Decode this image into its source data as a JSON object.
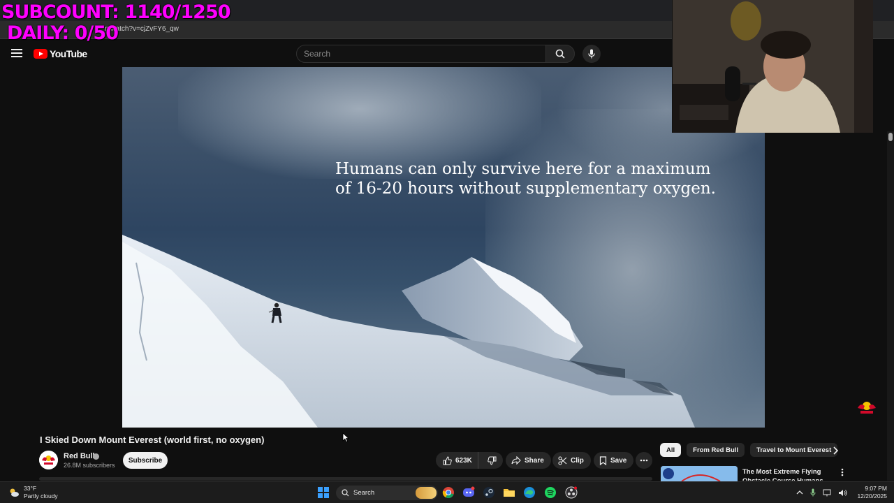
{
  "overlay": {
    "subcount": "SUBCOUNT: 1140/1250",
    "daily": "DAILY: 0/50"
  },
  "browser": {
    "address_fragment": "n/watch?v=cjZvFY6_qw"
  },
  "header": {
    "logo_text": "YouTube",
    "search_placeholder": "Search"
  },
  "video": {
    "caption_line1": "Humans can only survive here for a maximum",
    "caption_line2": "of 16-20 hours without supplementary oxygen."
  },
  "details": {
    "title": "I Skied Down Mount Everest (world first, no oxygen)",
    "channel": "Red Bull",
    "subscribers": "26.8M subscribers",
    "subscribe_label": "Subscribe",
    "likes": "623K",
    "share_label": "Share",
    "clip_label": "Clip",
    "save_label": "Save"
  },
  "chips": [
    {
      "label": "All",
      "active": true
    },
    {
      "label": "From Red Bull",
      "active": false
    },
    {
      "label": "Travel to Mount Everest",
      "active": false
    }
  ],
  "recommendation": {
    "title": "The Most Extreme Flying Obstacle Course Humans Hav..."
  },
  "taskbar": {
    "temperature": "33°F",
    "condition": "Partly cloudy",
    "search_label": "Search",
    "time": "9:07 PM",
    "date": "12/20/2025"
  },
  "colors": {
    "overlay_text": "#ff00ff",
    "youtube_red": "#ff0000",
    "background": "#0f0f0f",
    "win_accent": "#3aa0ff"
  }
}
